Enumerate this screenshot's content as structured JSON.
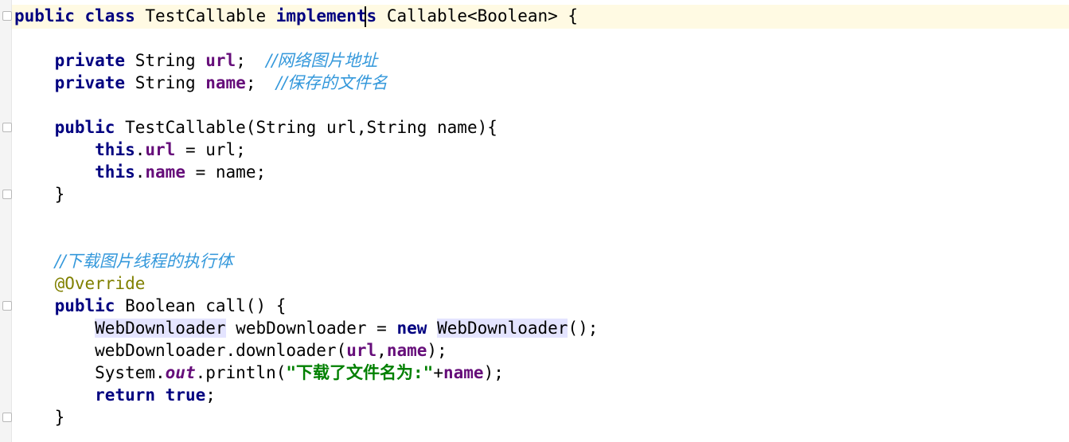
{
  "editor": {
    "lines": [
      {
        "tokens": [
          {
            "t": "public",
            "c": "kw"
          },
          {
            "t": " "
          },
          {
            "t": "class",
            "c": "kw"
          },
          {
            "t": " TestCallable "
          },
          {
            "t": "implements",
            "c": "kw"
          },
          {
            "t": " Callable<Boolean> {"
          }
        ]
      },
      {
        "tokens": []
      },
      {
        "tokens": [
          {
            "t": "    "
          },
          {
            "t": "private",
            "c": "kw"
          },
          {
            "t": " String "
          },
          {
            "t": "url",
            "c": "field"
          },
          {
            "t": ";  "
          },
          {
            "t": "//网络图片地址",
            "c": "comment"
          }
        ]
      },
      {
        "tokens": [
          {
            "t": "    "
          },
          {
            "t": "private",
            "c": "kw"
          },
          {
            "t": " String "
          },
          {
            "t": "name",
            "c": "field"
          },
          {
            "t": ";  "
          },
          {
            "t": "//保存的文件名",
            "c": "comment"
          }
        ]
      },
      {
        "tokens": []
      },
      {
        "tokens": [
          {
            "t": "    "
          },
          {
            "t": "public",
            "c": "kw"
          },
          {
            "t": " TestCallable(String url,String name){"
          }
        ]
      },
      {
        "tokens": [
          {
            "t": "        "
          },
          {
            "t": "this",
            "c": "kw"
          },
          {
            "t": "."
          },
          {
            "t": "url",
            "c": "field"
          },
          {
            "t": " = url;"
          }
        ]
      },
      {
        "tokens": [
          {
            "t": "        "
          },
          {
            "t": "this",
            "c": "kw"
          },
          {
            "t": "."
          },
          {
            "t": "name",
            "c": "field"
          },
          {
            "t": " = name;"
          }
        ]
      },
      {
        "tokens": [
          {
            "t": "    }"
          }
        ]
      },
      {
        "tokens": []
      },
      {
        "tokens": []
      },
      {
        "tokens": [
          {
            "t": "    "
          },
          {
            "t": "//下载图片线程的执行体",
            "c": "comment"
          }
        ]
      },
      {
        "tokens": [
          {
            "t": "    "
          },
          {
            "t": "@Override",
            "c": "anno"
          }
        ]
      },
      {
        "tokens": [
          {
            "t": "    "
          },
          {
            "t": "public",
            "c": "kw"
          },
          {
            "t": " Boolean call() {"
          }
        ]
      },
      {
        "tokens": [
          {
            "t": "        "
          },
          {
            "t": "WebDownloader",
            "c": "hl"
          },
          {
            "t": " webDownloader = "
          },
          {
            "t": "new",
            "c": "kw"
          },
          {
            "t": " "
          },
          {
            "t": "WebDownloader",
            "c": "hl"
          },
          {
            "t": "();"
          }
        ]
      },
      {
        "tokens": [
          {
            "t": "        webDownloader.downloader("
          },
          {
            "t": "url",
            "c": "field"
          },
          {
            "t": ","
          },
          {
            "t": "name",
            "c": "field"
          },
          {
            "t": ");"
          }
        ]
      },
      {
        "tokens": [
          {
            "t": "        System."
          },
          {
            "t": "out",
            "c": "static-field"
          },
          {
            "t": ".println("
          },
          {
            "t": "\"下载了文件名为:\"",
            "c": "str"
          },
          {
            "t": "+"
          },
          {
            "t": "name",
            "c": "field"
          },
          {
            "t": ");"
          }
        ]
      },
      {
        "tokens": [
          {
            "t": "        "
          },
          {
            "t": "return",
            "c": "kw"
          },
          {
            "t": " "
          },
          {
            "t": "true",
            "c": "kw"
          },
          {
            "t": ";"
          }
        ]
      },
      {
        "tokens": [
          {
            "t": "    }"
          }
        ]
      }
    ]
  }
}
